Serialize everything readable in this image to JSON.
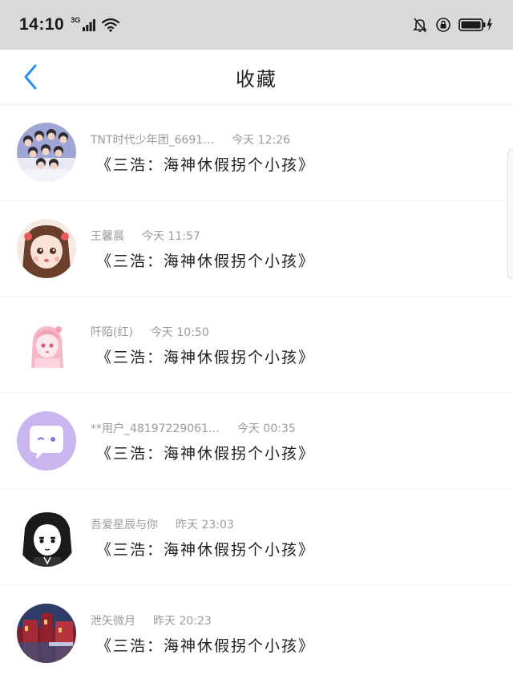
{
  "status_bar": {
    "time": "14:10",
    "network": "3G"
  },
  "header": {
    "title": "收藏"
  },
  "items": [
    {
      "name": "TNT时代少年团_6691…",
      "time": "今天 12:26",
      "title": "《三浩：海神休假拐个小孩》",
      "avatar": "group-photo"
    },
    {
      "name": "王馨晨",
      "time": "今天 11:57",
      "title": "《三浩：海神休假拐个小孩》",
      "avatar": "anime-girl-brown-hair"
    },
    {
      "name": "阡陌(红)",
      "time": "今天 10:50",
      "title": "《三浩：海神休假拐个小孩》",
      "avatar": "anime-girl-pink-hair"
    },
    {
      "name": "**用户_48197229061…",
      "time": "今天 00:35",
      "title": "《三浩：海神休假拐个小孩》",
      "avatar": "default-chat-bubble"
    },
    {
      "name": "吾爱星辰与你",
      "time": "昨天 23:03",
      "title": "《三浩：海神休假拐个小孩》",
      "avatar": "anime-girl-black-white"
    },
    {
      "name": "泄矢微月",
      "time": "昨天 20:23",
      "title": "《三浩：海神休假拐个小孩》",
      "avatar": "red-building-scene"
    }
  ],
  "colors": {
    "status_bar_bg": "#d9d9d9",
    "accent": "#2b8ff0",
    "meta_text": "#9a9a9a",
    "title_text": "#1e1e1e"
  }
}
